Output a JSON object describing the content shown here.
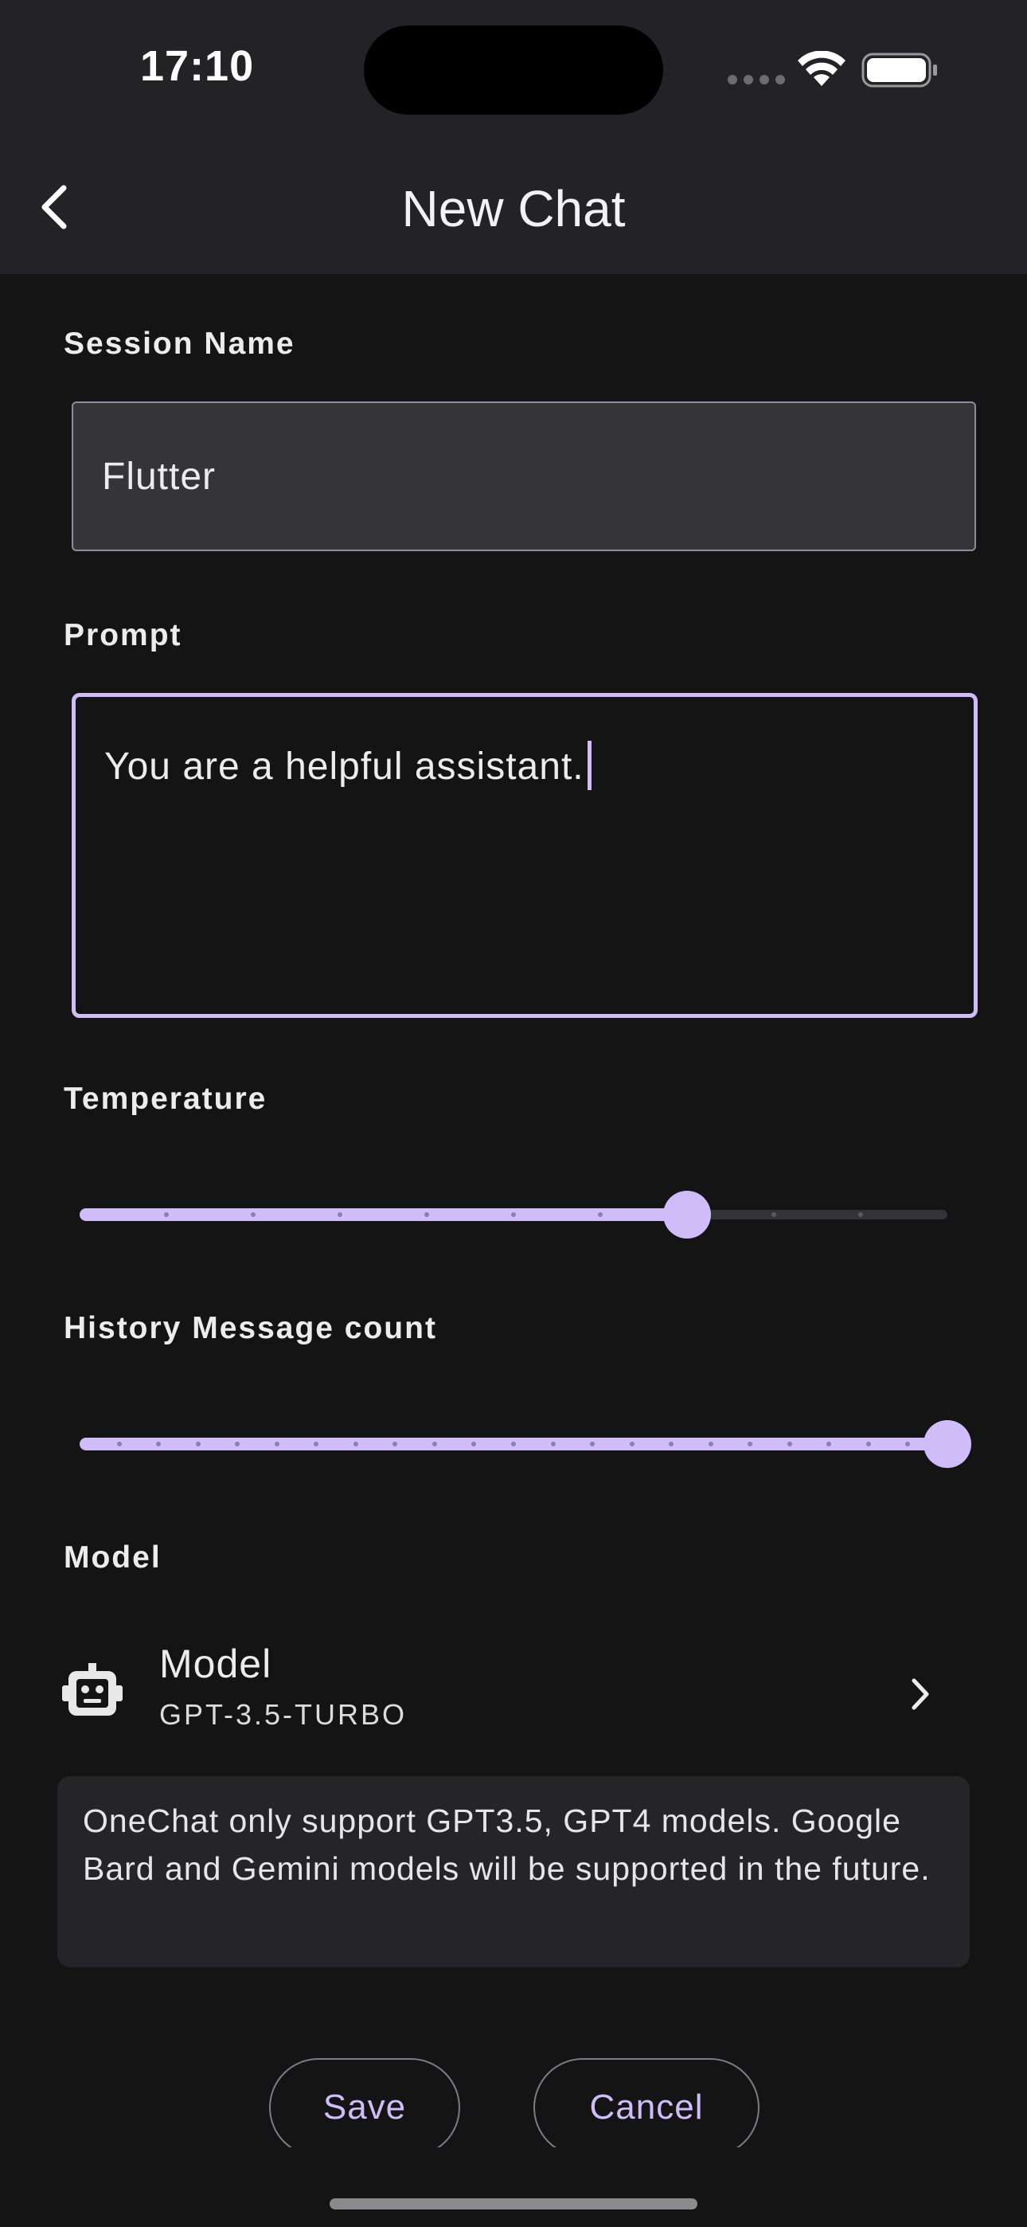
{
  "status_bar": {
    "time": "17:10"
  },
  "app_bar": {
    "title": "New Chat",
    "back_icon": "chevron-left-icon"
  },
  "form": {
    "session_name": {
      "label": "Session Name",
      "value": "Flutter"
    },
    "prompt": {
      "label": "Prompt",
      "value": "You are a helpful assistant."
    },
    "temperature": {
      "label": "Temperature",
      "value_fraction": 0.7,
      "divisions": 10
    },
    "history_message_count": {
      "label": "History Message count",
      "value_fraction": 1.0,
      "divisions": 22
    },
    "model": {
      "label": "Model",
      "row_title": "Model",
      "row_value": "GPT-3.5-TURBO",
      "icon": "robot-icon",
      "trailing_icon": "chevron-right-icon"
    },
    "info": "OneChat only support GPT3.5, GPT4 models. Google Bard and Gemini models will be supported in the future."
  },
  "actions": {
    "save_label": "Save",
    "cancel_label": "Cancel"
  },
  "colors": {
    "accent": "#cfbcf8",
    "background": "#141414",
    "app_bar": "#232326",
    "card": "#252528"
  }
}
